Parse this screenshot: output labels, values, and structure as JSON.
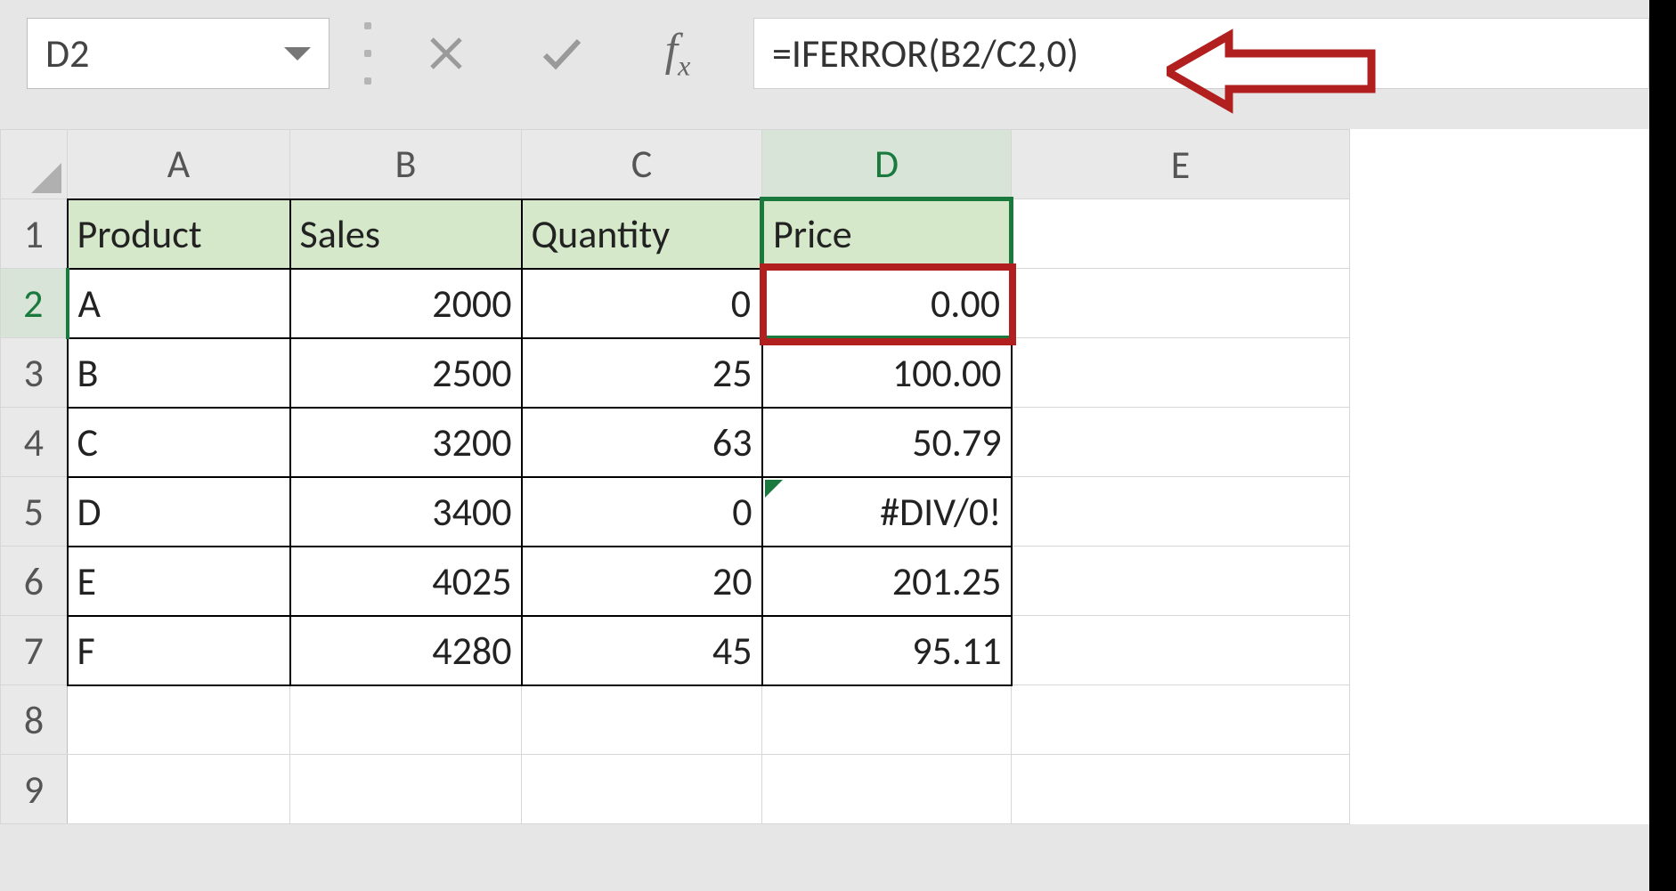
{
  "bar": {
    "namebox": "D2",
    "formula": "=IFERROR(B2/C2,0)"
  },
  "columns": [
    "A",
    "B",
    "C",
    "D",
    "E"
  ],
  "row_numbers": [
    1,
    2,
    3,
    4,
    5,
    6,
    7,
    8,
    9
  ],
  "headers": {
    "A": "Product",
    "B": "Sales",
    "C": "Quantity",
    "D": "Price"
  },
  "rows": [
    {
      "A": "A",
      "B": "2000",
      "C": "0",
      "D": "0.00"
    },
    {
      "A": "B",
      "B": "2500",
      "C": "25",
      "D": "100.00"
    },
    {
      "A": "C",
      "B": "3200",
      "C": "63",
      "D": "50.79"
    },
    {
      "A": "D",
      "B": "3400",
      "C": "0",
      "D": "#DIV/0!"
    },
    {
      "A": "E",
      "B": "4025",
      "C": "20",
      "D": "201.25"
    },
    {
      "A": "F",
      "B": "4280",
      "C": "45",
      "D": "95.11"
    }
  ],
  "active_cell": "D2",
  "chart_data": {
    "type": "table",
    "columns": [
      "Product",
      "Sales",
      "Quantity",
      "Price"
    ],
    "rows": [
      [
        "A",
        2000,
        0,
        0.0
      ],
      [
        "B",
        2500,
        25,
        100.0
      ],
      [
        "C",
        3200,
        63,
        50.79
      ],
      [
        "D",
        3400,
        0,
        "#DIV/0!"
      ],
      [
        "E",
        4025,
        20,
        201.25
      ],
      [
        "F",
        4280,
        45,
        95.11
      ]
    ]
  }
}
